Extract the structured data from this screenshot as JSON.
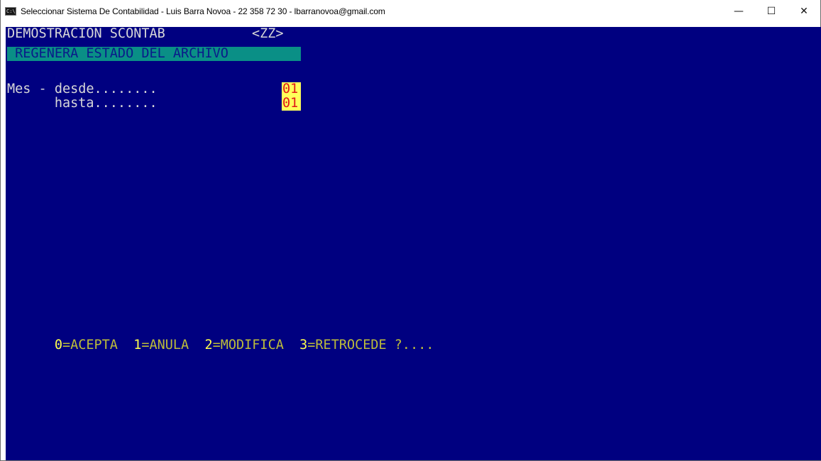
{
  "window": {
    "title": "Seleccionar Sistema De Contabilidad - Luis Barra Novoa - 22 358 72 30 - lbarranovoa@gmail.com",
    "icon": "C:\\",
    "controls": {
      "minimize": "—",
      "maximize": "☐",
      "close": "✕"
    }
  },
  "screen": {
    "company": "DEMOSTRACION SCONTAB",
    "company_code": "<ZZ>",
    "process_title": " REGENERA ESTADO DEL ARCHIVO",
    "fields": {
      "mes_desde_label": "Mes - desde........",
      "mes_desde_value": "01",
      "mes_hasta_label": "      hasta........",
      "mes_hasta_value": "01"
    },
    "menu": {
      "opt0_key": "0",
      "opt0_label": "=ACEPTA  ",
      "opt1_key": "1",
      "opt1_label": "=ANULA  ",
      "opt2_key": "2",
      "opt2_label": "=MODIFICA  ",
      "opt3_key": "3",
      "opt3_label": "=RETROCEDE ?...."
    }
  },
  "colors": {
    "console_bg": "#000080",
    "text": "#d8d8d8",
    "header_bg": "#0a8f86",
    "field_bg": "#ffff5a",
    "field_text": "#e01818",
    "menu_key": "#ffff4d",
    "menu_text": "#bdbd3a"
  }
}
